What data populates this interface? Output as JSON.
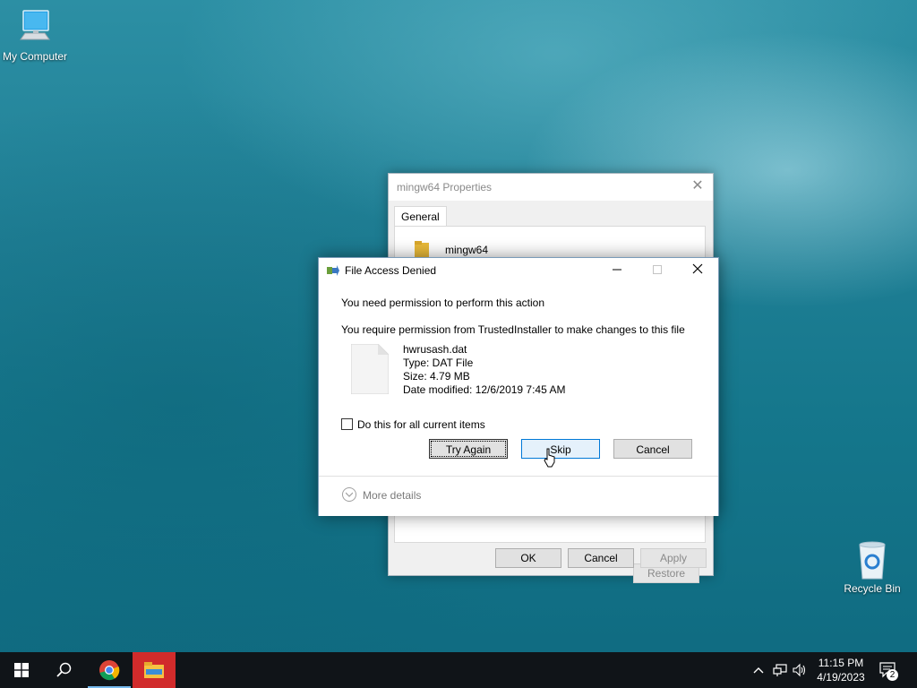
{
  "desktop": {
    "icons": [
      {
        "label": "My Computer",
        "icon": "computer-icon"
      },
      {
        "label": "Recycle Bin",
        "icon": "recycle-bin-icon"
      }
    ]
  },
  "properties_window": {
    "title": "mingw64 Properties",
    "tab": "General",
    "folder_name": "mingw64",
    "restore_label": "Restore",
    "ok_label": "OK",
    "cancel_label": "Cancel",
    "apply_label": "Apply"
  },
  "dialog": {
    "title": "File Access Denied",
    "message": "You need permission to perform this action",
    "detail": "You require permission from TrustedInstaller to make changes to this file",
    "file": {
      "name": "hwrusash.dat",
      "type": "Type: DAT File",
      "size": "Size: 4.79 MB",
      "modified": "Date modified: 12/6/2019 7:45 AM"
    },
    "checkbox_label": "Do this for all current items",
    "checkbox_checked": false,
    "buttons": {
      "try_again": "Try Again",
      "skip": "Skip",
      "cancel": "Cancel"
    },
    "more_details": "More details"
  },
  "taskbar": {
    "apps": [
      "start-icon",
      "search-icon",
      "chrome-icon",
      "file-explorer-icon"
    ],
    "time": "11:15 PM",
    "date": "4/19/2023",
    "notification_count": "2"
  }
}
